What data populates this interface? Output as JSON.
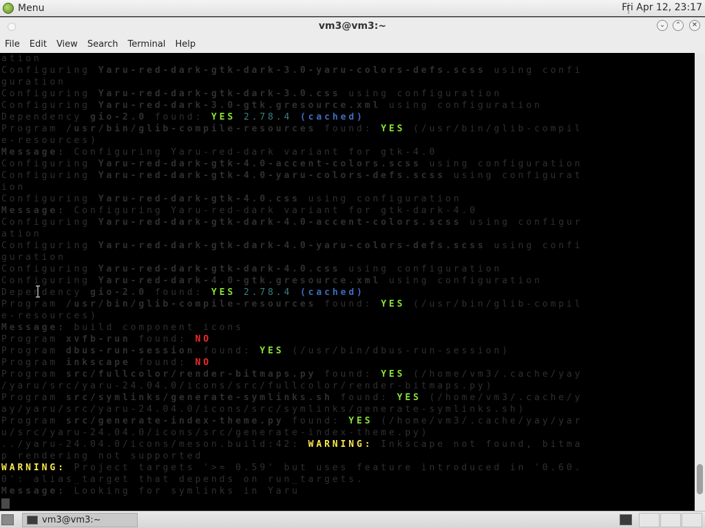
{
  "panel": {
    "menu_label": "Menu",
    "clock": "Fri Apr 12, 23:17"
  },
  "window": {
    "title": "vm3@vm3:~",
    "menus": [
      "File",
      "Edit",
      "View",
      "Search",
      "Terminal",
      "Help"
    ]
  },
  "terminal": {
    "lines": [
      [
        [
          "ation",
          "dim"
        ]
      ],
      [
        [
          "Configuring ",
          "dim"
        ],
        [
          "Yaru-red-dark-gtk-dark-3.0-yaru-colors-defs.scss",
          "dim bold"
        ],
        [
          " using confi",
          "dim"
        ]
      ],
      [
        [
          "guration",
          "dim"
        ]
      ],
      [
        [
          "Configuring ",
          "dim"
        ],
        [
          "Yaru-red-dark-gtk-dark-3.0.css",
          "dim bold"
        ],
        [
          " using configuration",
          "dim"
        ]
      ],
      [
        [
          "Configuring ",
          "dim"
        ],
        [
          "Yaru-red-dark-3.0-gtk.gresource.xml",
          "dim bold"
        ],
        [
          " using configuration",
          "dim"
        ]
      ],
      [
        [
          "Dependency ",
          "dim"
        ],
        [
          "gio-2.0",
          "dim bold"
        ],
        [
          " found: ",
          "dim"
        ],
        [
          "YES",
          "grn"
        ],
        [
          " ",
          ""
        ],
        [
          "2.78.4",
          "cyan"
        ],
        [
          " ",
          ""
        ],
        [
          "(cached)",
          "blu"
        ]
      ],
      [
        [
          "Program ",
          "dim"
        ],
        [
          "/usr/bin/glib-compile-resources",
          "dim bold"
        ],
        [
          " found: ",
          "dim"
        ],
        [
          "YES",
          "grn"
        ],
        [
          " (/usr/bin/glib-compil",
          "dim"
        ]
      ],
      [
        [
          "e-resources)",
          "dim"
        ]
      ],
      [
        [
          "Message:",
          "dim bold"
        ],
        [
          " Configuring Yaru-red-dark variant for gtk-4.0",
          "dim"
        ]
      ],
      [
        [
          "Configuring ",
          "dim"
        ],
        [
          "Yaru-red-dark-gtk-4.0-accent-colors.scss",
          "dim bold"
        ],
        [
          " using configuration",
          "dim"
        ]
      ],
      [
        [
          "Configuring ",
          "dim"
        ],
        [
          "Yaru-red-dark-gtk-4.0-yaru-colors-defs.scss",
          "dim bold"
        ],
        [
          " using configurat",
          "dim"
        ]
      ],
      [
        [
          "ion",
          "dim"
        ]
      ],
      [
        [
          "Configuring ",
          "dim"
        ],
        [
          "Yaru-red-dark-gtk-4.0.css",
          "dim bold"
        ],
        [
          " using configuration",
          "dim"
        ]
      ],
      [
        [
          "Message:",
          "dim bold"
        ],
        [
          " Configuring Yaru-red-dark variant for gtk-dark-4.0",
          "dim"
        ]
      ],
      [
        [
          "Configuring ",
          "dim"
        ],
        [
          "Yaru-red-dark-gtk-dark-4.0-accent-colors.scss",
          "dim bold"
        ],
        [
          " using configur",
          "dim"
        ]
      ],
      [
        [
          "ation",
          "dim"
        ]
      ],
      [
        [
          "Configuring ",
          "dim"
        ],
        [
          "Yaru-red-dark-gtk-dark-4.0-yaru-colors-defs.scss",
          "dim bold"
        ],
        [
          " using confi",
          "dim"
        ]
      ],
      [
        [
          "guration",
          "dim"
        ]
      ],
      [
        [
          "Configuring ",
          "dim"
        ],
        [
          "Yaru-red-dark-gtk-dark-4.0.css",
          "dim bold"
        ],
        [
          " using configuration",
          "dim"
        ]
      ],
      [
        [
          "Configuring ",
          "dim"
        ],
        [
          "Yaru-red-dark-4.0-gtk.gresource.xml",
          "dim bold"
        ],
        [
          " using configuration",
          "dim"
        ]
      ],
      [
        [
          "Dependency ",
          "dim"
        ],
        [
          "gio-2.0",
          "dim bold"
        ],
        [
          " found: ",
          "dim"
        ],
        [
          "YES",
          "grn"
        ],
        [
          " ",
          ""
        ],
        [
          "2.78.4",
          "cyan"
        ],
        [
          " ",
          ""
        ],
        [
          "(cached)",
          "blu"
        ]
      ],
      [
        [
          "Program ",
          "dim"
        ],
        [
          "/usr/bin/glib-compile-resources",
          "dim bold"
        ],
        [
          " found: ",
          "dim"
        ],
        [
          "YES",
          "grn"
        ],
        [
          " (/usr/bin/glib-compil",
          "dim"
        ]
      ],
      [
        [
          "e-resources)",
          "dim"
        ]
      ],
      [
        [
          "Message:",
          "dim bold"
        ],
        [
          " build component icons",
          "dim"
        ]
      ],
      [
        [
          "Program ",
          "dim"
        ],
        [
          "xvfb-run",
          "dim bold"
        ],
        [
          " found: ",
          "dim"
        ],
        [
          "NO",
          "red"
        ]
      ],
      [
        [
          "Program ",
          "dim"
        ],
        [
          "dbus-run-session",
          "dim bold"
        ],
        [
          " found: ",
          "dim"
        ],
        [
          "YES",
          "grn"
        ],
        [
          " (/usr/bin/dbus-run-session)",
          "dim"
        ]
      ],
      [
        [
          "Program ",
          "dim"
        ],
        [
          "inkscape",
          "dim bold"
        ],
        [
          " found: ",
          "dim"
        ],
        [
          "NO",
          "red"
        ]
      ],
      [
        [
          "Program ",
          "dim"
        ],
        [
          "src/fullcolor/render-bitmaps.py",
          "dim bold"
        ],
        [
          " found: ",
          "dim"
        ],
        [
          "YES",
          "grn"
        ],
        [
          " (/home/vm3/.cache/yay",
          "dim"
        ]
      ],
      [
        [
          "/yaru/src/yaru-24.04.0/icons/src/fullcolor/render-bitmaps.py)",
          "dim"
        ]
      ],
      [
        [
          "Program ",
          "dim"
        ],
        [
          "src/symlinks/generate-symlinks.sh",
          "dim bold"
        ],
        [
          " found: ",
          "dim"
        ],
        [
          "YES",
          "grn"
        ],
        [
          " (/home/vm3/.cache/y",
          "dim"
        ]
      ],
      [
        [
          "ay/yaru/src/yaru-24.04.0/icons/src/symlinks/generate-symlinks.sh)",
          "dim"
        ]
      ],
      [
        [
          "Program ",
          "dim"
        ],
        [
          "src/generate-index-theme.py",
          "dim bold"
        ],
        [
          " found: ",
          "dim"
        ],
        [
          "YES",
          "grn"
        ],
        [
          " (/home/vm3/.cache/yay/yar",
          "dim"
        ]
      ],
      [
        [
          "u/src/yaru-24.04.0/icons/src/generate-index-theme.py)",
          "dim"
        ]
      ],
      [
        [
          "../yaru-24.04.0/icons/meson.build:42: ",
          "dim"
        ],
        [
          "WARNING:",
          "yel"
        ],
        [
          " Inkscape not found, bitma",
          "dim"
        ]
      ],
      [
        [
          "p rendering not supported",
          "dim"
        ]
      ],
      [
        [
          "WARNING:",
          "yel"
        ],
        [
          " Project targets '>= 0.59' but uses feature introduced in '0.60.",
          "dim"
        ]
      ],
      [
        [
          "0': alias_target that depends on run_targets.",
          "dim"
        ]
      ],
      [
        [
          "Message:",
          "dim bold"
        ],
        [
          " Looking for symlinks in Yaru",
          "dim"
        ]
      ]
    ]
  },
  "taskbar": {
    "task_label": "vm3@vm3:~"
  },
  "icons": {
    "menu_logo": "linux-mint-logo-icon",
    "close": "close-icon",
    "maximize": "maximize-icon",
    "minimize": "minimize-icon"
  }
}
